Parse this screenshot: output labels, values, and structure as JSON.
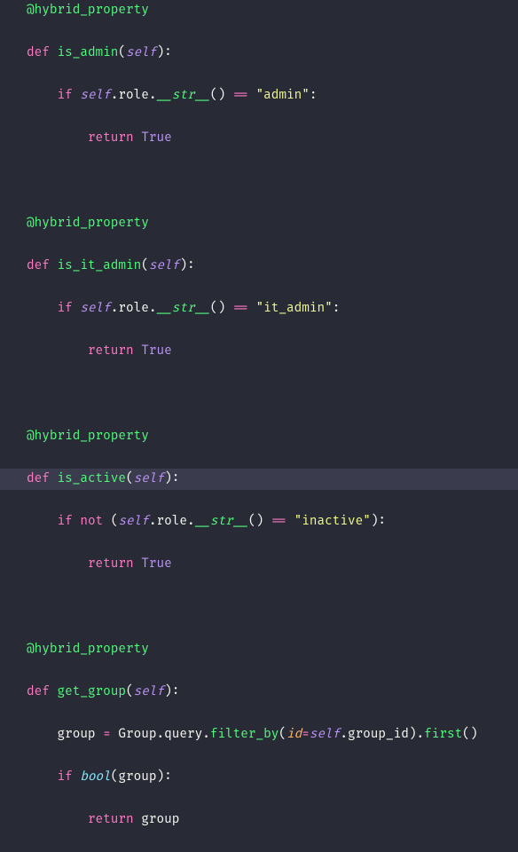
{
  "code": {
    "decorator": "@hybrid_property",
    "kw_def": "def",
    "kw_if": "if",
    "kw_not": "not",
    "kw_return": "return",
    "self": "self",
    "true": "True",
    "bool": "bool",
    "func_is_admin": "is_admin",
    "func_is_it_admin": "is_it_admin",
    "func_is_active": "is_active",
    "func_get_group": "get_group",
    "attr_role": "role",
    "dunder_str": "__str__",
    "str_admin": "\"admin\"",
    "str_it_admin": "\"it_admin\"",
    "str_inactive": "\"inactive\"",
    "var_group": "group",
    "cls_group": "Group",
    "attr_query": "query",
    "method_filter_by": "filter_by",
    "param_id": "id",
    "attr_group_id": "group_id",
    "method_first": "first",
    "eq": "=",
    "eqeq": "=="
  }
}
